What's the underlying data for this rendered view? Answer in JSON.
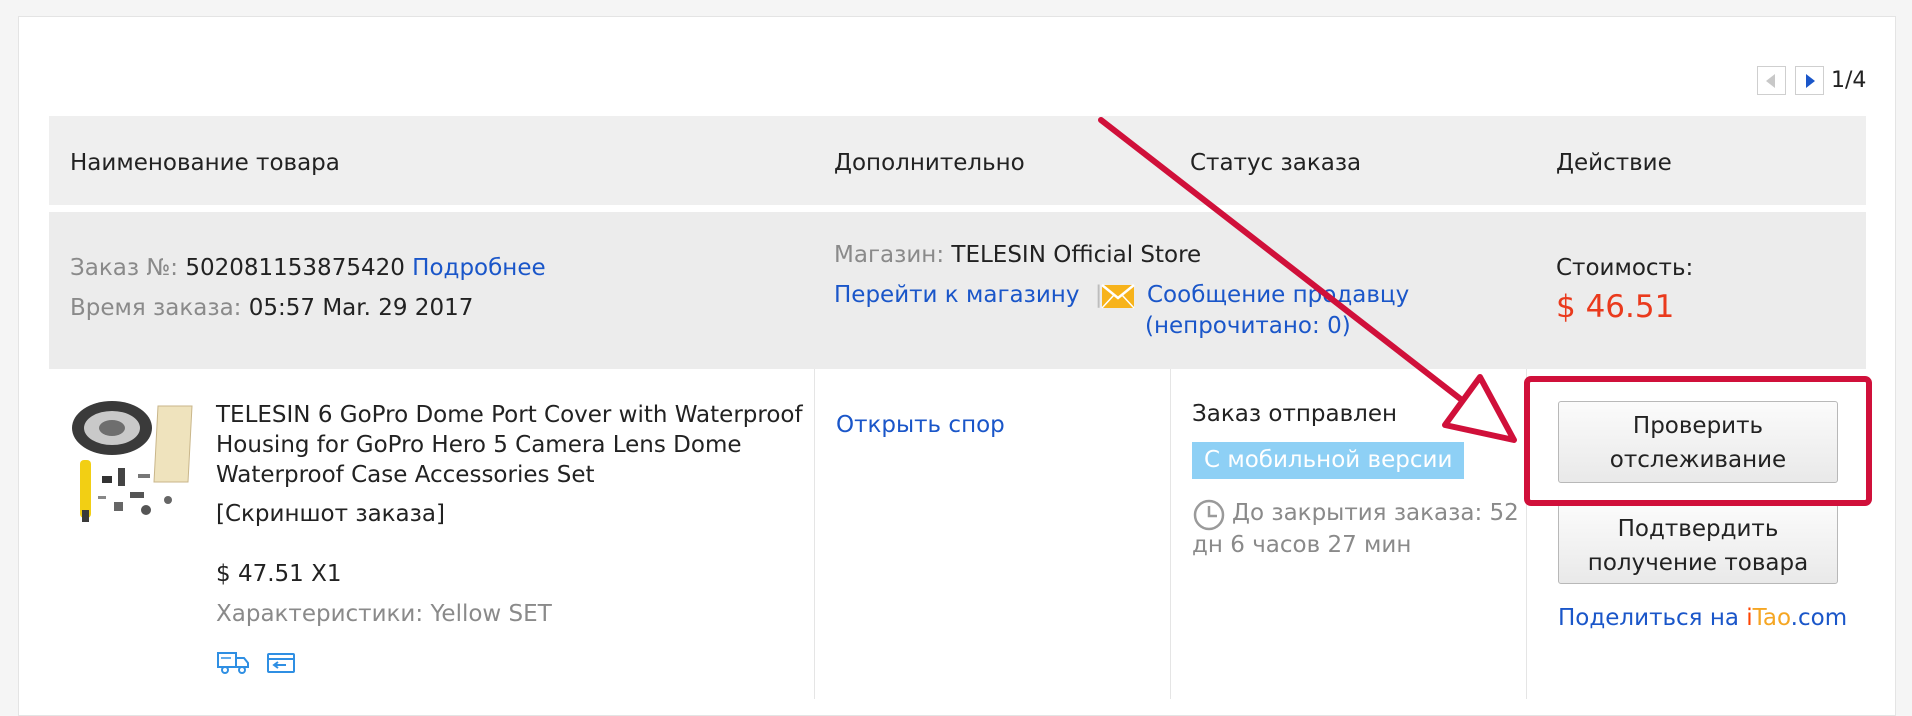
{
  "pager": {
    "prev_icon": "triangle-left-icon",
    "next_icon": "triangle-right-icon",
    "text": "1/4"
  },
  "table_header": {
    "product": "Наименование товара",
    "extra": "Дополнительно",
    "status": "Статус заказа",
    "action": "Действие"
  },
  "order": {
    "number_label": "Заказ №:",
    "number": "502081153875420",
    "details_link": "Подробнее",
    "time_label": "Время заказа:",
    "time": "05:57 Mar. 29 2017",
    "store_label": "Магазин:",
    "store_name": "TELESIN Official Store",
    "go_to_store": "Перейти к магазину",
    "separator": "|",
    "message_seller": "Сообщение продавцу",
    "unread": "(непрочитано: 0)",
    "cost_label": "Стоимость:",
    "cost": "$ 46.51"
  },
  "product": {
    "title": "TELESIN 6 GoPro Dome Port Cover with Waterproof Housing for GoPro Hero 5 Camera Lens Dome Waterproof Case Accessories Set",
    "screenshot_link": "[Скриншот заказа]",
    "price_qty": "$ 47.51 X1",
    "specs_label": "Характеристики:",
    "specs_value": "Yellow SET",
    "open_dispute": "Открыть спор",
    "status": "Заказ отправлен",
    "mobile_badge": "С мобильной версии",
    "countdown_line1": "До закрытия заказа: 52",
    "countdown_line2": "дн 6 часов 27 мин",
    "track_button_line1": "Проверить",
    "track_button_line2": "отслеживание",
    "confirm_button_line1": "Подтвердить",
    "confirm_button_line2": "получение товара",
    "share_prefix": "Поделиться на ",
    "share_i": "i",
    "share_tao": "Tao",
    "share_com": ".com"
  },
  "colors": {
    "link": "#1a56c9",
    "price": "#ea3a1d",
    "badge": "#8ed0f5",
    "annotation": "#d0103a",
    "itao_i": "#ff4400",
    "itao_tao": "#f5a623"
  }
}
